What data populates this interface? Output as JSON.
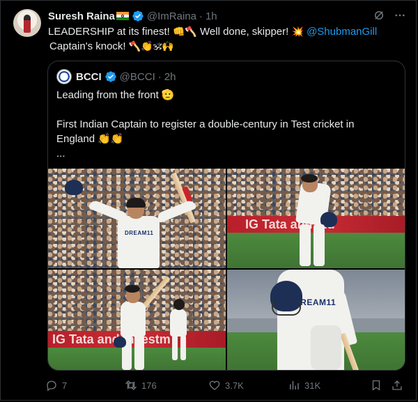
{
  "tweet": {
    "author_name": "Suresh Raina",
    "author_handle": "@ImRaina",
    "separator": "·",
    "time": "1h",
    "text_part1": "LEADERSHIP at its finest! ",
    "emoji_1": "👊",
    "emoji_2": "🪓",
    "text_part2": " Well done, skipper! ",
    "emoji_3": "💥",
    "mention": " @ShubmanGill",
    "text_part3": "Captain's knock! ",
    "emoji_4": "🪓",
    "emoji_5": "👏",
    "emoji_6": " 🕉🙌"
  },
  "quote": {
    "author_name": "BCCI",
    "author_handle": "@BCCI",
    "separator": "·",
    "time": "2h",
    "line1": "Leading from the front 🫡",
    "line2": "First Indian Captain to register a double-century in Test cricket in",
    "line3": "England 👏👏",
    "line4": "..."
  },
  "photos": {
    "board_text_2": "IG Tata and Ind",
    "board_text_3": "IG Tata and investm",
    "jersey_text": "DREAM11"
  },
  "actions": {
    "replies": "7",
    "reposts": "176",
    "likes": "3.7K",
    "views": "31K"
  },
  "colors": {
    "accent": "#1d9bf0",
    "muted": "#71767b",
    "text": "#e7e9ea",
    "background": "#000000",
    "border": "#2f3336"
  }
}
